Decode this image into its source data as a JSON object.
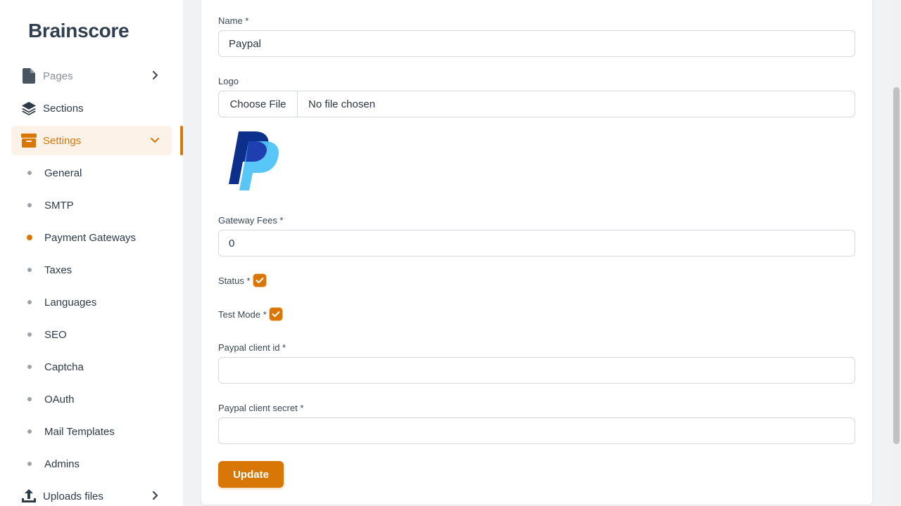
{
  "brand": "Brainscore",
  "sidebar": {
    "pages": "Pages",
    "sections": "Sections",
    "settings": "Settings",
    "sub_items": [
      "General",
      "SMTP",
      "Payment Gateways",
      "Taxes",
      "Languages",
      "SEO",
      "Captcha",
      "OAuth",
      "Mail Templates",
      "Admins"
    ],
    "uploads": "Uploads files"
  },
  "form": {
    "name_label": "Name *",
    "name_value": "Paypal",
    "logo_label": "Logo",
    "choose_file": "Choose File",
    "no_file": "No file chosen",
    "fees_label": "Gateway Fees *",
    "fees_value": "0",
    "status_label": "Status *",
    "status_checked": true,
    "test_mode_label": "Test Mode *",
    "test_mode_checked": true,
    "client_id_label": "Paypal client id *",
    "client_id_value": "",
    "client_secret_label": "Paypal client secret *",
    "client_secret_value": "",
    "update_button": "Update"
  },
  "colors": {
    "accent": "#d97706",
    "active_bg": "#fdf2e7",
    "paypal_dark": "#003087",
    "paypal_light": "#4fc3f7"
  },
  "icons": {
    "pages": "file-icon",
    "sections": "layers-icon",
    "settings": "archive-icon",
    "uploads": "upload-icon",
    "logo": "paypal-logo"
  }
}
